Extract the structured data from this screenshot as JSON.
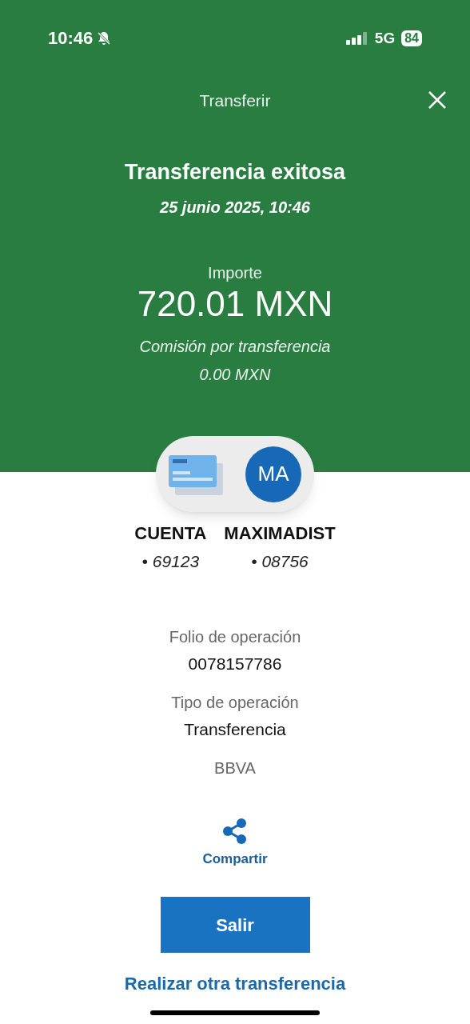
{
  "status_bar": {
    "time": "10:46",
    "network": "5G",
    "battery": "84"
  },
  "header": {
    "title": "Transferir"
  },
  "result": {
    "heading": "Transferencia exitosa",
    "date": "25 junio 2025, 10:46",
    "amount_label": "Importe",
    "amount": "720.01 MXN",
    "fee_label": "Comisión por transferencia",
    "fee": "0.00 MXN"
  },
  "parties": [
    {
      "kind": "card",
      "name": "CUENTA",
      "number": "• 69123"
    },
    {
      "kind": "avatar",
      "initials": "MA",
      "name": "MAXIMADIST",
      "number": "• 08756"
    }
  ],
  "details": [
    {
      "label": "Folio de operación",
      "value": "0078157786"
    },
    {
      "label": "Tipo de operación",
      "value": "Transferencia"
    },
    {
      "label": "BBVA"
    }
  ],
  "share": {
    "label": "Compartir"
  },
  "primary_button": "Salir",
  "link": "Realizar otra transferencia"
}
